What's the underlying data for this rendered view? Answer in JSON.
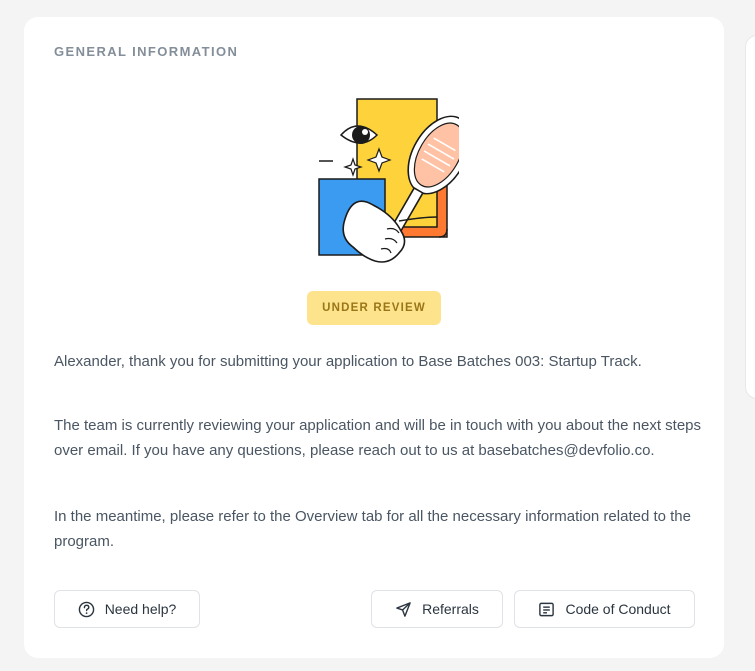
{
  "section_title": "GENERAL INFORMATION",
  "status_badge": "UNDER REVIEW",
  "paragraphs": {
    "thanks": "Alexander, thank you for submitting your application to Base Batches 003: Startup Track.",
    "review": "The team is currently reviewing your application and will be in touch with you about the next steps over email. If you have any questions, please reach out to us at basebatches@devfolio.co.",
    "meantime": "In the meantime, please refer to the Overview tab for all the necessary information related to the program."
  },
  "buttons": {
    "help": {
      "label": "Need help?",
      "icon": "question-circle-icon"
    },
    "referrals": {
      "label": "Referrals",
      "icon": "paper-plane-icon"
    },
    "code_of_conduct": {
      "label": "Code of Conduct",
      "icon": "document-lines-icon"
    }
  },
  "colors": {
    "badge_bg": "#fde38b",
    "badge_text": "#9a7618",
    "illustration_yellow": "#fdd23a",
    "illustration_orange": "#ff7a30",
    "illustration_blue": "#3a9bf0"
  }
}
